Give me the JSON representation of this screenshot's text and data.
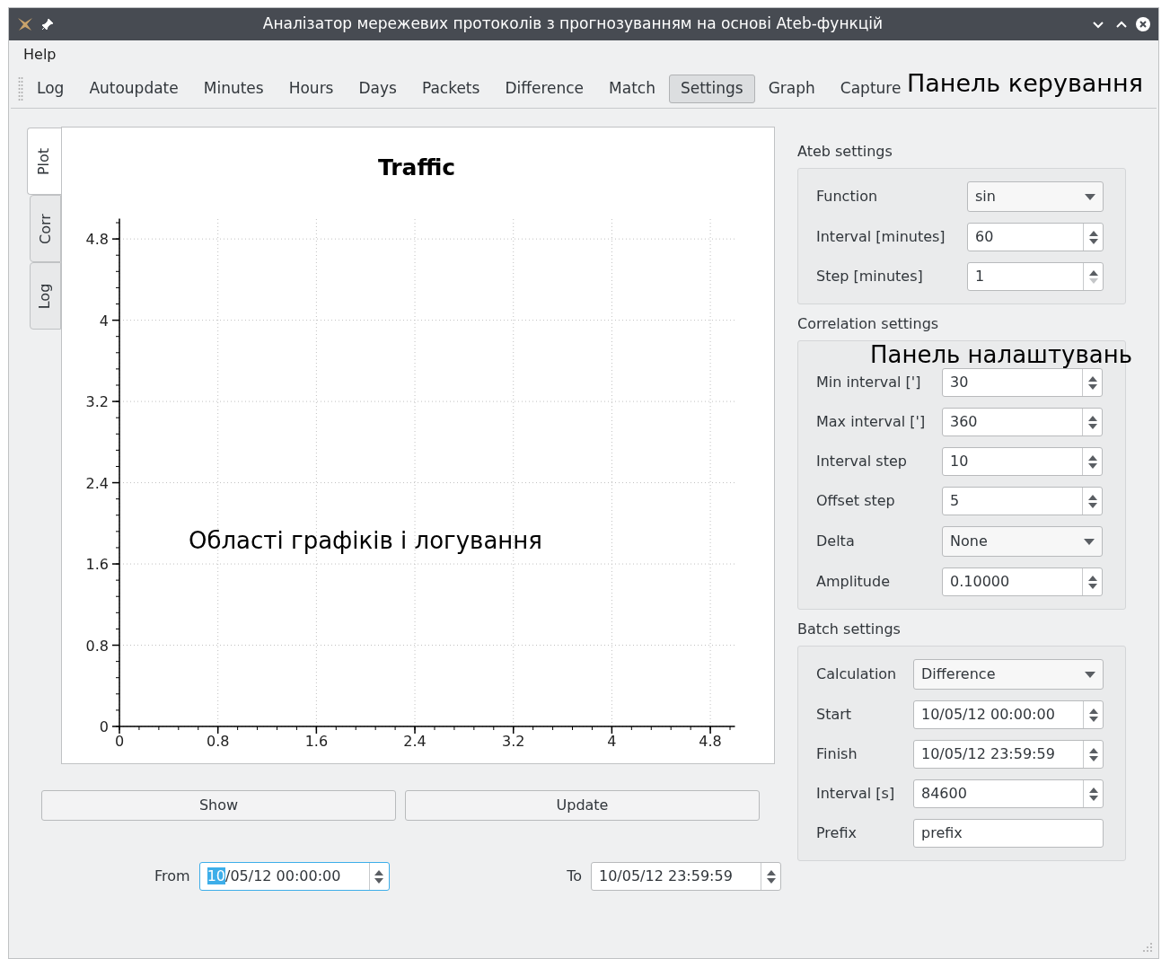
{
  "window": {
    "title": "Аналізатор мережевих протоколів з прогнозуванням на основі Ateb-функцій"
  },
  "menu": [
    "Help"
  ],
  "toolbar": [
    {
      "label": "Log",
      "selected": false
    },
    {
      "label": "Autoupdate",
      "selected": false
    },
    {
      "label": "Minutes",
      "selected": false
    },
    {
      "label": "Hours",
      "selected": false
    },
    {
      "label": "Days",
      "selected": false
    },
    {
      "label": "Packets",
      "selected": false
    },
    {
      "label": "Difference",
      "selected": false
    },
    {
      "label": "Match",
      "selected": false
    },
    {
      "label": "Settings",
      "selected": true
    },
    {
      "label": "Graph",
      "selected": false
    },
    {
      "label": "Capture",
      "selected": false
    }
  ],
  "side_tabs": [
    {
      "label": "Plot",
      "selected": true
    },
    {
      "label": "Corr",
      "selected": false
    },
    {
      "label": "Log",
      "selected": false
    }
  ],
  "plot": {
    "chart_data": {
      "type": "line",
      "title": "Traffic",
      "grid": true,
      "xlim": [
        0,
        5
      ],
      "ylim": [
        0,
        5
      ],
      "xticks": [
        {
          "value": 0,
          "label": "0"
        },
        {
          "value": 0.8,
          "label": "0.8"
        },
        {
          "value": 1.6,
          "label": "1.6"
        },
        {
          "value": 2.4,
          "label": "2.4"
        },
        {
          "value": 3.2,
          "label": "3.2"
        },
        {
          "value": 4,
          "label": "4"
        },
        {
          "value": 4.8,
          "label": "4.8"
        }
      ],
      "yticks": [
        {
          "value": 0,
          "label": "0"
        },
        {
          "value": 0.8,
          "label": "0.8"
        },
        {
          "value": 1.6,
          "label": "1.6"
        },
        {
          "value": 2.4,
          "label": "2.4"
        },
        {
          "value": 3.2,
          "label": "3.2"
        },
        {
          "value": 4,
          "label": "4"
        },
        {
          "value": 4.8,
          "label": "4.8"
        }
      ]
    }
  },
  "buttons": [
    "Show",
    "Update"
  ],
  "range": [
    {
      "label": "From",
      "selection": "10",
      "value": "/05/12 00:00:00",
      "focused": true
    },
    {
      "label": "To",
      "value": "10/05/12 23:59:59",
      "focused": false
    }
  ],
  "groups": [
    {
      "title": "Ateb settings",
      "fields": [
        {
          "label": "Function",
          "kind": "combo",
          "value": "sin"
        },
        {
          "label": "Interval [minutes]",
          "kind": "spin",
          "value": "60",
          "at_minimum": false
        },
        {
          "label": "Step [minutes]",
          "kind": "spin",
          "value": "1",
          "at_minimum": true
        }
      ]
    },
    {
      "title": "Correlation settings",
      "fields": [
        {
          "label": "Min interval [']",
          "kind": "spin",
          "value": "30",
          "at_minimum": false
        },
        {
          "label": "Max interval [']",
          "kind": "spin",
          "value": "360",
          "at_minimum": false
        },
        {
          "label": "Interval step",
          "kind": "spin",
          "value": "10",
          "at_minimum": false
        },
        {
          "label": "Offset step",
          "kind": "spin",
          "value": "5",
          "at_minimum": false
        },
        {
          "label": "Delta",
          "kind": "combo",
          "value": "None"
        },
        {
          "label": "Amplitude",
          "kind": "spin",
          "value": "0.10000",
          "at_minimum": false
        }
      ]
    },
    {
      "title": "Batch settings",
      "fields": [
        {
          "label": "Calculation",
          "kind": "combo",
          "value": "Difference"
        },
        {
          "label": "Start",
          "kind": "spin",
          "value": "10/05/12 00:00:00",
          "at_minimum": false
        },
        {
          "label": "Finish",
          "kind": "spin",
          "value": "10/05/12 23:59:59",
          "at_minimum": false
        },
        {
          "label": "Interval [s]",
          "kind": "spin",
          "value": "84600",
          "at_minimum": false
        },
        {
          "label": "Prefix",
          "kind": "text",
          "value": "prefix"
        }
      ]
    }
  ],
  "annotations": [
    {
      "kind": "toolbar",
      "text": "Панель керування"
    },
    {
      "kind": "settings",
      "text": "Панель налаштувань"
    },
    {
      "kind": "plot",
      "text": "Області графіків і логування"
    }
  ]
}
